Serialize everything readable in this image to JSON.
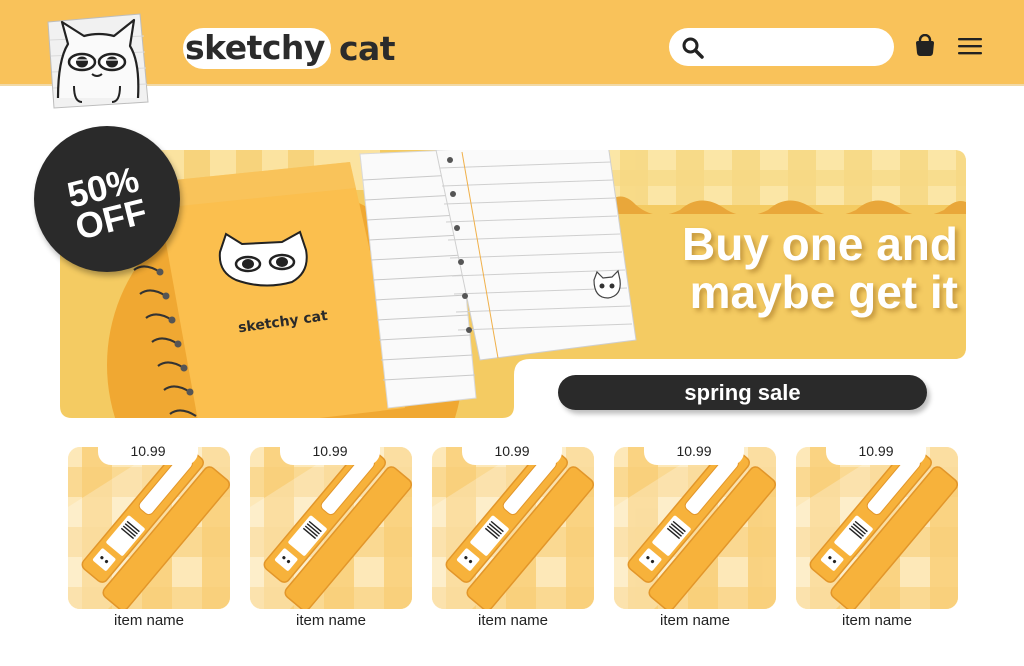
{
  "header": {
    "brand_word1": "sketchy",
    "brand_word2": "cat",
    "search_placeholder": "",
    "icons": [
      "search-icon",
      "shopping-bag-icon",
      "hamburger-menu-icon"
    ]
  },
  "hero": {
    "badge_line1": "50%",
    "badge_line2": "OFF",
    "headline_line1": "Buy one and",
    "headline_line2": "maybe get it",
    "sale_label": "spring sale",
    "notebook_label": "sketchy cat"
  },
  "products": [
    {
      "price": "10.99",
      "name": "item name"
    },
    {
      "price": "10.99",
      "name": "item name"
    },
    {
      "price": "10.99",
      "name": "item name"
    },
    {
      "price": "10.99",
      "name": "item name"
    },
    {
      "price": "10.99",
      "name": "item name"
    }
  ],
  "colors": {
    "header_bg": "#f9c25a",
    "accent_orange": "#f7b23b",
    "dark": "#2a2a2a",
    "light_yellow": "#fde8b8"
  }
}
